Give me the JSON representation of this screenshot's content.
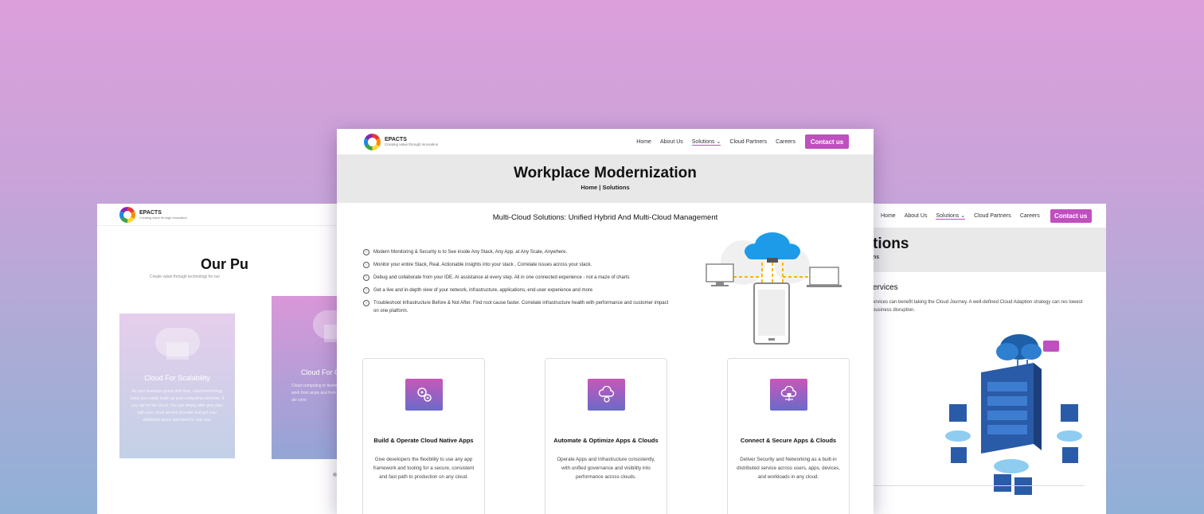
{
  "brand": {
    "name": "EPACTS",
    "tagline": "Creating value through innovation"
  },
  "nav": {
    "home": "Home",
    "about": "About Us",
    "solutions": "Solutions",
    "partners": "Cloud Partners",
    "careers": "Careers",
    "contact": "Contact us"
  },
  "left_page": {
    "title": "Our Pu",
    "subtitle": "Create value through technology for our",
    "cards": [
      {
        "title": "Cloud For Scalability",
        "text": "As your business grows with time, cloud technology helps you easily scale up your computing solutions. If you opt for the cloud, You can simply alter your plan with your cloud service provider and get your additional space allocated for your use."
      },
      {
        "title": "Cloud For C",
        "text": "Cloud computing m flexible one for your can work from anyw and from home, wh anywhere alo conn"
      }
    ]
  },
  "center_page": {
    "banner_title": "Workplace Modernization",
    "breadcrumb": "Home | Solutions",
    "section_title": "Multi-Cloud Solutions: Unified Hybrid And Multi-Cloud Management",
    "bullets": [
      "Modern Monitoring & Security is to See inside Any Stack, Any App, at Any Scale, Anywhere.",
      "Monitor your entire Stack, Real, Actionable insights into your stack , Correlate issues across your stack.",
      " Debug and collaborate from your IDE. AI assistance at every step. All in one connected experience - not a maze of charts",
      "Get a live and in-depth view of your network, infrastructure, applications, end-user experience and more",
      "Troubleshoot Infrastructure Before & Not After. Find root cause faster. Correlate infrastructure health with performance and customer impact on one platform."
    ],
    "cards": [
      {
        "title": "Build & Operate Cloud Native Apps",
        "text": "Give developers the flexibility to use any app framework and tooling for a secure, consistent and fast path to production on any cloud.",
        "icon": "gears-icon"
      },
      {
        "title": "Automate & Optimize Apps & Clouds",
        "text": "Operate Apps and Infrastructure consistently, with unified governance and visibility into performance across clouds.",
        "icon": "cloud-settings-icon"
      },
      {
        "title": "Connect & Secure Apps & Clouds",
        "text": "Deliver Security and Networking as a built-in distributed service across users, apps, devices, and workloads in any cloud.",
        "icon": "cloud-lock-icon"
      }
    ]
  },
  "right_page": {
    "banner_title": "tions",
    "breadcrumb": "ns",
    "heading": "ervices",
    "paragraph": "ervices can benefit taking the Cloud Journey. A well-defined Cloud Adaption strategy can res lowest business disruption."
  },
  "colors": {
    "accent": "#c04fc0",
    "banner_gray": "#e8e8e8",
    "cloud_blue": "#1e9be8",
    "bg_top": "#dc9fdc",
    "bg_bottom": "#90b0d6"
  }
}
